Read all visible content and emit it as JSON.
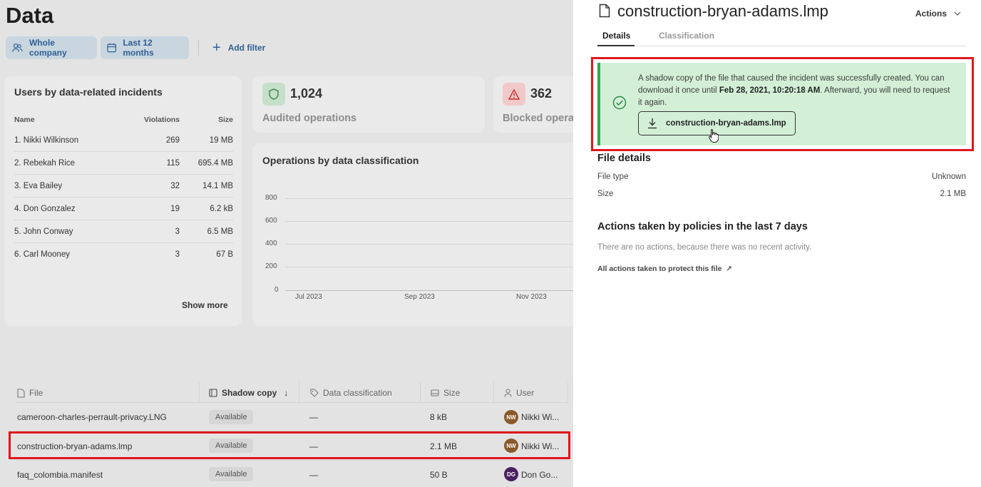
{
  "page": {
    "title": "Data"
  },
  "filters": {
    "company": "Whole company",
    "period": "Last 12 months",
    "add_filter": "Add filter"
  },
  "users_card": {
    "title": "Users by data-related incidents",
    "columns": [
      "Name",
      "Violations",
      "Size"
    ],
    "rows": [
      {
        "name": "1. Nikki Wilkinson",
        "violations": "269",
        "size": "19 MB"
      },
      {
        "name": "2. Rebekah Rice",
        "violations": "115",
        "size": "695.4 MB"
      },
      {
        "name": "3. Eva Bailey",
        "violations": "32",
        "size": "14.1 MB"
      },
      {
        "name": "4. Don Gonzalez",
        "violations": "19",
        "size": "6.2 kB"
      },
      {
        "name": "5. John Conway",
        "violations": "3",
        "size": "6.5 MB"
      },
      {
        "name": "6. Carl Mooney",
        "violations": "3",
        "size": "67 B"
      }
    ],
    "show_more": "Show more"
  },
  "stats": {
    "audited": {
      "value": "1,024",
      "label": "Audited operations",
      "color": "#5aa36a"
    },
    "blocked": {
      "value": "362",
      "label": "Blocked operat",
      "color": "#d9534f"
    }
  },
  "ops_chart": {
    "title": "Operations by data classification",
    "y_ticks": [
      "800",
      "600",
      "400",
      "200",
      "0"
    ],
    "x_ticks": [
      "Jul 2023",
      "Sep 2023",
      "Nov 2023"
    ]
  },
  "files_table": {
    "headers": {
      "file": "File",
      "shadow": "Shadow copy",
      "classification": "Data classification",
      "size": "Size",
      "user": "User"
    },
    "rows": [
      {
        "file": "cameroon-charles-perrault-privacy.LNG",
        "shadow": "Available",
        "classification": "—",
        "size": "8 kB",
        "user": "Nikki Wi...",
        "initials": "NW",
        "avatar_color": "#8b5a2b"
      },
      {
        "file": "construction-bryan-adams.lmp",
        "shadow": "Available",
        "classification": "—",
        "size": "2.1 MB",
        "user": "Nikki Wi...",
        "initials": "NW",
        "avatar_color": "#8b5a2b"
      },
      {
        "file": "faq_colombia.manifest",
        "shadow": "Available",
        "classification": "—",
        "size": "50 B",
        "user": "Don Go...",
        "initials": "DG",
        "avatar_color": "#4a2060"
      }
    ]
  },
  "panel": {
    "title": "construction-bryan-adams.lmp",
    "actions": "Actions",
    "tabs": [
      "Details",
      "Classification"
    ],
    "success": {
      "text_pre": "A shadow copy of the file that caused the incident was successfully created. You can download it once until ",
      "date": "Feb 28, 2021, 10:20:18 AM",
      "text_post": ". Afterward, you will need to request it again.",
      "button": "construction-bryan-adams.lmp"
    },
    "file_details": {
      "title": "File details",
      "type_key": "File type",
      "type_val": "Unknown",
      "size_key": "Size",
      "size_val": "2.1 MB"
    },
    "policies": {
      "title": "Actions taken by policies in the last 7 days",
      "empty": "There are no actions, because there was no recent activity.",
      "link": "All actions taken to protect this file"
    }
  }
}
